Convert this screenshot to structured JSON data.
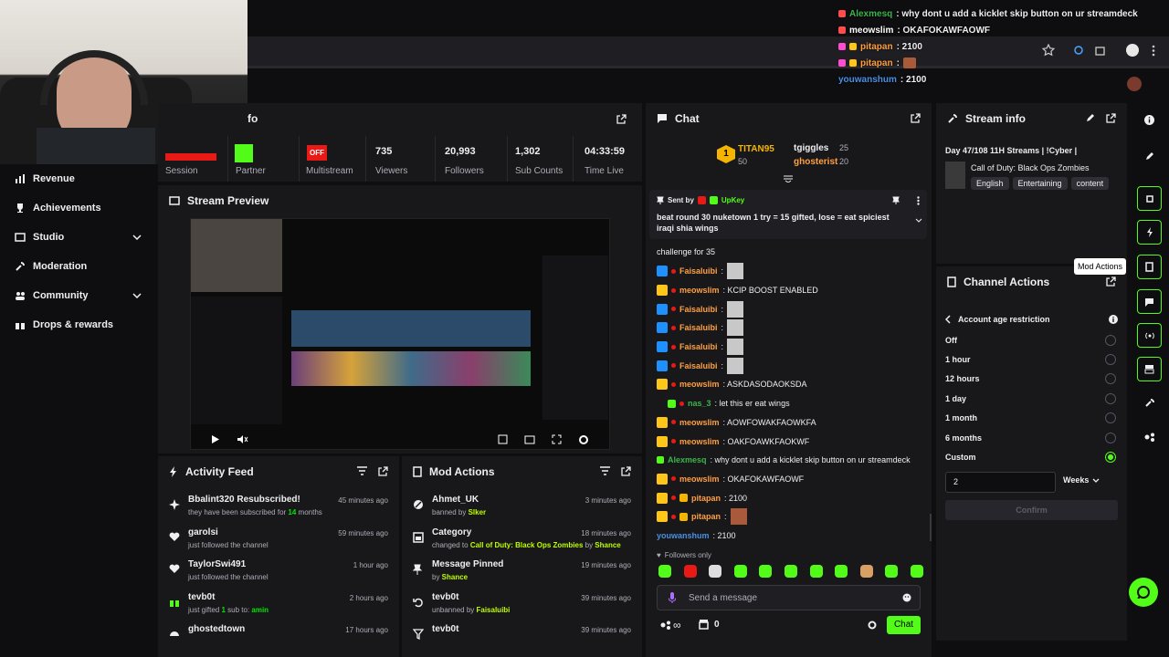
{
  "overlay_chat": [
    {
      "name": "Alexmesq",
      "color": "#3ab54a",
      "text": ": why dont u add a kicklet skip button on ur streamdeck"
    },
    {
      "name": "meowslim",
      "color": "#ffffff",
      "text": ": OKAFOKAWFAOWF"
    },
    {
      "name": "pitapan",
      "color": "#ff9f40",
      "text": ": 2100"
    },
    {
      "name": "pitapan",
      "color": "#ff9f40",
      "text": ":"
    },
    {
      "name": "youwanshum",
      "color": "#4a90e2",
      "text": ": 2100"
    }
  ],
  "sidebar": {
    "items": [
      {
        "label": "Revenue",
        "icon": "chart-icon"
      },
      {
        "label": "Achievements",
        "icon": "trophy-icon"
      },
      {
        "label": "Studio",
        "icon": "video-icon",
        "chevron": true
      },
      {
        "label": "Moderation",
        "icon": "wrench-icon"
      },
      {
        "label": "Community",
        "icon": "people-icon",
        "chevron": true
      },
      {
        "label": "Drops & rewards",
        "icon": "gift-icon"
      }
    ]
  },
  "stats_panel": {
    "title_fragment": "fo",
    "session_label": "Session",
    "partner_label": "Partner",
    "multistream_label": "Multistream",
    "multistream_badge": "OFF",
    "viewers_value": "735",
    "viewers_label": "Viewers",
    "followers_value": "20,993",
    "followers_label": "Followers",
    "subs_value": "1,302",
    "subs_label": "Sub Counts",
    "time_value": "04:33:59",
    "time_label": "Time Live"
  },
  "preview": {
    "title": "Stream Preview"
  },
  "activity": {
    "title": "Activity Feed",
    "items": [
      {
        "title": "Bbalint320 Resubscribed!",
        "sub_a": "they have been subscribed for ",
        "sub_b": "14",
        "sub_c": " months",
        "time": "45 minutes ago"
      },
      {
        "title": "garolsi",
        "sub_a": "just followed the channel",
        "time": "59 minutes ago"
      },
      {
        "title": "TaylorSwi491",
        "sub_a": "just followed the channel",
        "time": "1 hour ago"
      },
      {
        "title": "tevb0t",
        "sub_a": "just gifted ",
        "sub_b": "1",
        "sub_c": " sub to: ",
        "sub_d": "amin",
        "time": "2 hours ago"
      },
      {
        "title": "ghostedtown",
        "time": "17 hours ago"
      }
    ]
  },
  "mod_actions": {
    "title": "Mod Actions",
    "items": [
      {
        "title": "Ahmet_UK",
        "sub_a": "banned by ",
        "sub_b": "Slker",
        "time": "3 minutes ago"
      },
      {
        "title": "Category",
        "sub_a": "changed to ",
        "sub_b": "Call of Duty: Black Ops Zombies",
        "sub_c": " by ",
        "sub_d": "Shance",
        "time": "18 minutes ago"
      },
      {
        "title": "Message Pinned",
        "sub_a": "by ",
        "sub_b": "Shance",
        "time": "19 minutes ago"
      },
      {
        "title": "tevb0t",
        "sub_a": "unbanned by ",
        "sub_b": "Faisaluibi",
        "time": "39 minutes ago"
      },
      {
        "title": "tevb0t",
        "time": "39 minutes ago"
      }
    ]
  },
  "chat": {
    "title": "Chat",
    "leader": {
      "rank": "1",
      "name": "TITAN95",
      "count": "50",
      "second": "tgiggles",
      "second_count": "25",
      "third": "ghosterist",
      "third_count": "20"
    },
    "pinned": {
      "sent_by": "Sent by",
      "user": "UpKey",
      "text": "beat round 30 nuketown 1 try = 15 gifted, lose = eat spiciest iraqi shia wings"
    },
    "partial_line": "challenge for 35",
    "messages": [
      {
        "name": "Faisaluibi",
        "color": "#ff9f40",
        "text": ":",
        "img": true
      },
      {
        "name": "meowslim",
        "color": "#ff9f40",
        "text": ": KCIP BOOST ENABLED"
      },
      {
        "name": "Faisaluibi",
        "color": "#ff9f40",
        "text": ":",
        "img": true
      },
      {
        "name": "Faisaluibi",
        "color": "#ff9f40",
        "text": ":",
        "img": true
      },
      {
        "name": "Faisaluibi",
        "color": "#ff9f40",
        "text": ":",
        "img": true
      },
      {
        "name": "Faisaluibi",
        "color": "#ff9f40",
        "text": ":",
        "img": true
      },
      {
        "name": "meowslim",
        "color": "#ff9f40",
        "text": ": ASKDASODAOKSDA"
      },
      {
        "name": "nas_3",
        "color": "#3ab54a",
        "text": ": let this er eat wings"
      },
      {
        "name": "meowslim",
        "color": "#ff9f40",
        "text": ": AOWFOWAKFAOWKFA"
      },
      {
        "name": "meowslim",
        "color": "#ff9f40",
        "text": ": OAKFOAWKFAOKWF"
      },
      {
        "name": "Alexmesq",
        "color": "#3ab54a",
        "text": ": why dont u add a kicklet skip button on ur streamdeck"
      },
      {
        "name": "meowslim",
        "color": "#ff9f40",
        "text": ": OKAFOKAWFAOWF"
      },
      {
        "name": "pitapan",
        "color": "#ff9f40",
        "text": ": 2100"
      },
      {
        "name": "pitapan",
        "color": "#ff9f40",
        "text": ":",
        "img": true
      },
      {
        "name": "youwanshum",
        "color": "#4a90e2",
        "text": ": 2100"
      }
    ],
    "followers_only": "Followers only",
    "input_placeholder": "Send a message",
    "points": "0",
    "send_label": "Chat"
  },
  "stream_info": {
    "title": "Stream info",
    "stream_title": "Day 47/108 11H Streams | !Cyber |",
    "category": "Call of Duty: Black Ops Zombies",
    "tags": [
      "English",
      "Entertaining",
      "content"
    ]
  },
  "tooltip": "Mod Actions",
  "channel_actions": {
    "title": "Channel Actions",
    "section": "Account age restriction",
    "options": [
      {
        "label": "Off"
      },
      {
        "label": "1 hour"
      },
      {
        "label": "12 hours"
      },
      {
        "label": "1 day"
      },
      {
        "label": "1 month"
      },
      {
        "label": "6 months"
      },
      {
        "label": "Custom",
        "selected": true
      }
    ],
    "custom_value": "2",
    "unit": "Weeks",
    "confirm": "Confirm"
  },
  "colors": {
    "accent": "#53fc18",
    "panel": "#18181b",
    "bg": "#0e0e10"
  }
}
